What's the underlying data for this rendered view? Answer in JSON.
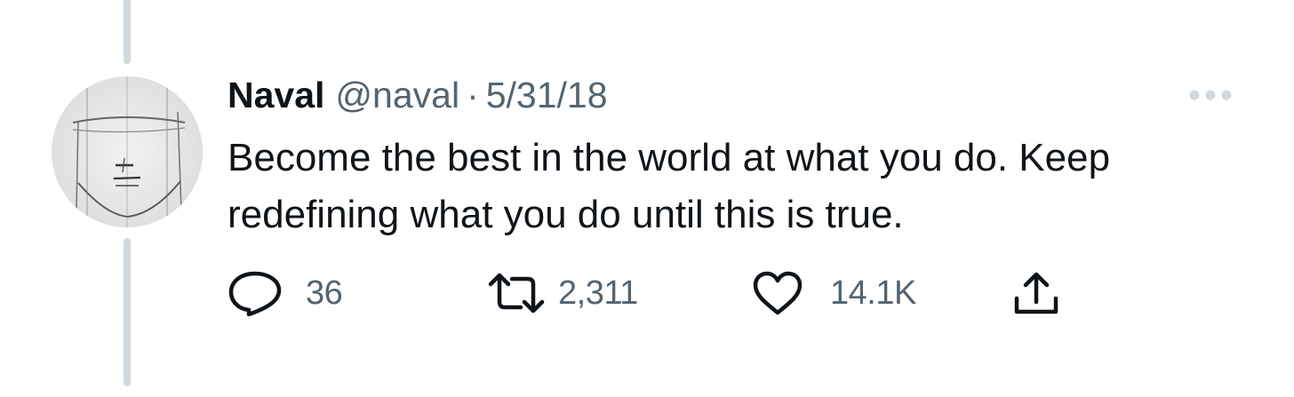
{
  "tweet": {
    "author_name": "Naval",
    "handle": "@naval",
    "separator": "·",
    "date": "5/31/18",
    "text": "Become the best in the world at what you do. Keep\nredefining what you do until this is true."
  },
  "actions": {
    "replies": "36",
    "retweets": "2,311",
    "likes": "14.1K"
  },
  "icons": {
    "avatar": "sketch-face-avatar",
    "more": "more-dots-icon",
    "reply": "reply-icon",
    "retweet": "retweet-icon",
    "like": "heart-icon",
    "share": "share-icon"
  },
  "colors": {
    "text_primary": "#0f1419",
    "text_secondary": "#536471",
    "thread_line": "#cfd9de",
    "more_dots": "#cfd9de"
  }
}
